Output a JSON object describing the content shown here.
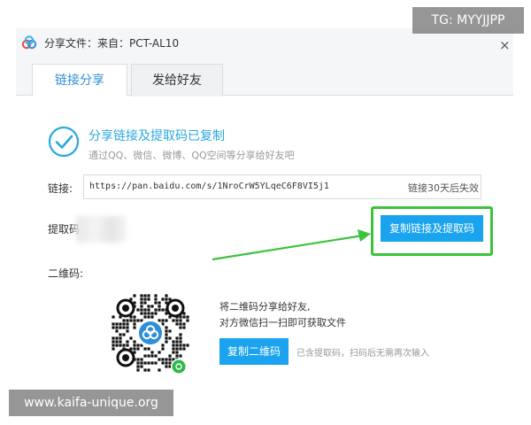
{
  "window": {
    "title": "分享文件：来自：PCT-AL10",
    "close_symbol": "×",
    "app_icon": "baidu-pan-icon"
  },
  "tabs": [
    {
      "label": "链接分享",
      "active": true
    },
    {
      "label": "发给好友",
      "active": false
    }
  ],
  "success": {
    "icon": "check-circle-icon",
    "title": "分享链接及提取码已复制",
    "subtitle": "通过QQ、微信、微博、QQ空间等分享给好友吧"
  },
  "link": {
    "label": "链接:",
    "url": "https://pan.baidu.com/s/1NroCrW5YLqeC6F8VI5j1",
    "expire": "链接30天后失效"
  },
  "code": {
    "label": "提取码"
  },
  "buttons": {
    "copy_link_code": "复制链接及提取码",
    "copy_qr": "复制二维码"
  },
  "qr": {
    "label": "二维码:",
    "tip_line1": "将二维码分享给好友,",
    "tip_line2": "对方微信扫一扫即可获取文件",
    "note": "已含提取码，扫码后无需再次输入"
  },
  "watermarks": {
    "tg": "TG: MYYJJPP",
    "site": "www.kaifa-unique.org"
  },
  "colors": {
    "accent": "#1aa3ee",
    "success": "#2aa8e0",
    "highlight": "#3cc23c"
  }
}
